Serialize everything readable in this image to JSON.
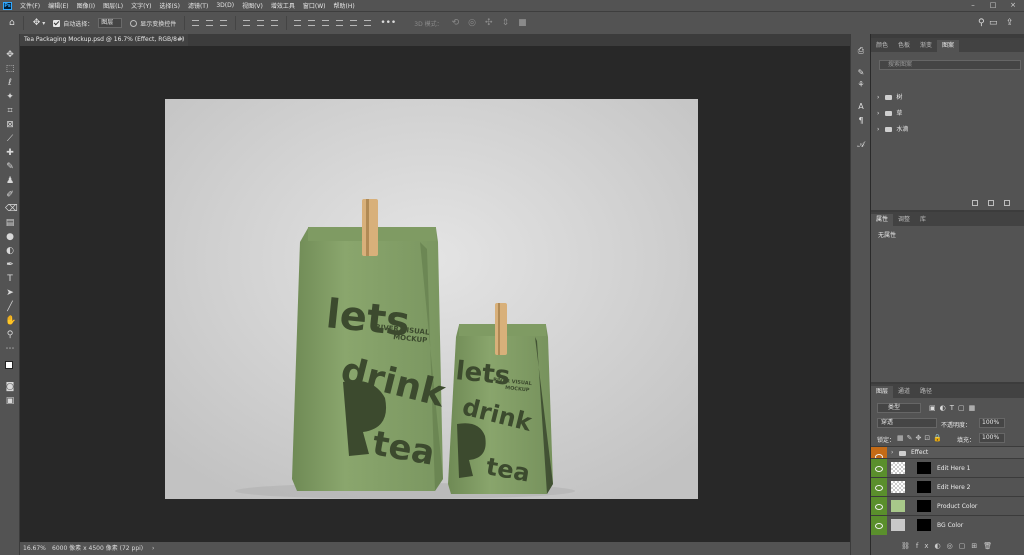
{
  "menubar": {
    "logo": "Ps",
    "items": [
      "文件(F)",
      "编辑(E)",
      "图像(I)",
      "图层(L)",
      "文字(Y)",
      "选择(S)",
      "滤镜(T)",
      "3D(D)",
      "视图(V)",
      "增效工具",
      "窗口(W)",
      "帮助(H)"
    ]
  },
  "options": {
    "auto_select_label": "自动选择：",
    "auto_select_value": "图层",
    "show_transform_label": "显示变换控件",
    "mode_3d_label": "3D 模式："
  },
  "document_tab": {
    "title": "Tea Packaging Mockup.psd @ 16.7% (Effect, RGB/8#)",
    "close": "×"
  },
  "statusbar": {
    "zoom": "16.67%",
    "doc_info": "6000 像素 x 4500 像素 (72 ppi)",
    "arrow": "›"
  },
  "colors_panel": {
    "tabs": [
      "颜色",
      "色板",
      "渐变",
      "图案"
    ],
    "active_tab": 3,
    "search_placeholder": "搜索图案",
    "folders": [
      "树",
      "草",
      "水滴"
    ]
  },
  "properties_panel": {
    "tabs": [
      "属性",
      "调整",
      "库"
    ],
    "active_tab": 0,
    "empty_text": "无属性"
  },
  "layers_panel": {
    "tabs": [
      "图层",
      "通道",
      "路径"
    ],
    "active_tab": 0,
    "filter_label": "类型",
    "blend_mode": "穿透",
    "opacity_label": "不透明度：",
    "opacity_value": "100%",
    "lock_label": "锁定：",
    "fill_label": "填充：",
    "fill_value": "100%",
    "layers": [
      {
        "name": "Effect",
        "type": "group",
        "eye_color": "#c46b16"
      },
      {
        "name": "Edit Here 1",
        "type": "smart"
      },
      {
        "name": "Edit Here 2",
        "type": "smart"
      },
      {
        "name": "Product Color",
        "type": "fill",
        "thumb_color": "#a8c88a"
      },
      {
        "name": "BG Color",
        "type": "fill",
        "thumb_color": "#c8c8c8"
      }
    ]
  },
  "mockup": {
    "big_bag": {
      "line1": "lets",
      "line2": "drink",
      "line3": "tea",
      "brand1": "RIVER VISUAL",
      "brand2": "MOCKUP"
    },
    "small_bag": {
      "line1": "lets",
      "line2": "drink",
      "line3": "tea",
      "brand1": "RIVER VISUAL",
      "brand2": "MOCKUP"
    },
    "bag_color": "#7e9a62",
    "text_color": "#3c4a2e",
    "clip_color": "#d8b07a"
  },
  "accent": "#31a8ff"
}
